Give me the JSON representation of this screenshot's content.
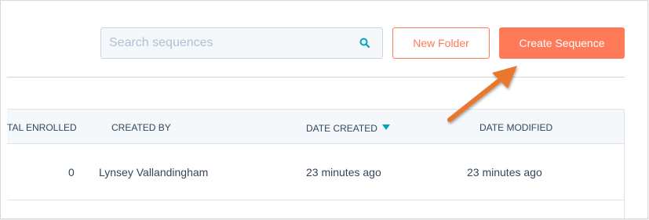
{
  "toolbar": {
    "search_placeholder": "Search sequences",
    "search_value": "",
    "new_folder_label": "New Folder",
    "create_sequence_label": "Create Sequence"
  },
  "table": {
    "columns": [
      {
        "label": "TAL ENROLLED"
      },
      {
        "label": "CREATED BY"
      },
      {
        "label": "DATE CREATED",
        "sorted": "descending"
      },
      {
        "label": "DATE MODIFIED"
      }
    ],
    "rows": [
      {
        "total_enrolled": "0",
        "created_by": "Lynsey Vallandingham",
        "date_created": "23 minutes ago",
        "date_modified": "23 minutes ago"
      }
    ]
  },
  "colors": {
    "accent": "#ff7a59",
    "sort_indicator": "#00a4bd",
    "annotation_arrow": "#e8782f",
    "text": "#33475b",
    "border": "#cbd6e2"
  },
  "icons": {
    "search": "search-icon",
    "sort": "sort-descending-icon",
    "annotation": "annotation-arrow"
  }
}
